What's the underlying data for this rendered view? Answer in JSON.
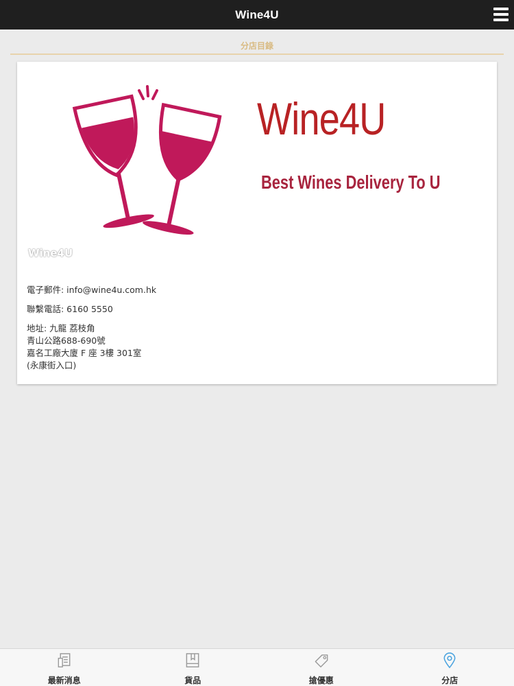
{
  "header": {
    "title": "Wine4U",
    "menu_icon": "hamburger-menu-icon"
  },
  "section": {
    "title": "分店目錄"
  },
  "store": {
    "banner": {
      "brand_name": "Wine4U",
      "tagline": "Best Wines Delivery To U",
      "caption": "Wine4U",
      "logo_icon": "clinking-wine-glasses-icon",
      "colors": {
        "brand_red": "#b82224",
        "glass_pink": "#c0195a",
        "tagline": "#a8243e"
      }
    },
    "email": "電子郵件: info@wine4u.com.hk",
    "phone": "聯繫電話: 6160 5550",
    "address": [
      "地址: 九龍 荔枝角",
      "青山公路688-690號",
      "嘉名工廠大廈 F 座 3樓 301室",
      "(永康街入口)"
    ]
  },
  "tabbar": {
    "tabs": [
      {
        "label": "最新消息",
        "icon": "news-icon"
      },
      {
        "label": "貨品",
        "icon": "book-icon"
      },
      {
        "label": "搶優惠",
        "icon": "tag-icon"
      },
      {
        "label": "分店",
        "icon": "location-pin-icon",
        "active": true
      }
    ],
    "active_color": "#4aa3df"
  }
}
